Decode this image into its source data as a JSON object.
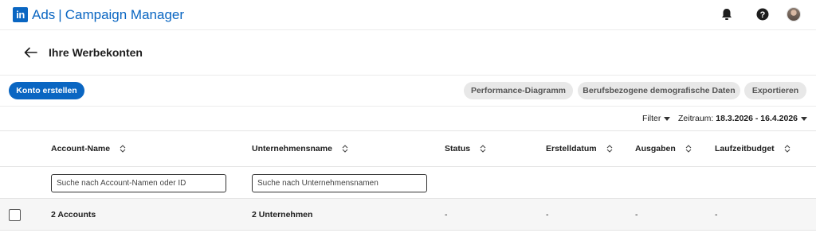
{
  "header": {
    "logo_text": "in",
    "product": "Ads",
    "app_name": "Campaign Manager",
    "brand_color": "#0a66c2",
    "icons": [
      "bell-icon",
      "help-icon",
      "avatar"
    ]
  },
  "page": {
    "title": "Ihre Werbekonten"
  },
  "actions": {
    "create_account": "Konto erstellen",
    "performance_chart": "Performance-Diagramm",
    "demographics": "Berufsbezogene demografische Daten",
    "export": "Exportieren"
  },
  "filter_bar": {
    "filter_label": "Filter",
    "date_range_label": "Zeitraum:",
    "date_range_value": "18.3.2026 - 16.4.2026"
  },
  "table": {
    "columns": [
      "Account-Name",
      "Unternehmensname",
      "Status",
      "Erstelldatum",
      "Ausgaben",
      "Laufzeitbudget"
    ],
    "search_account_placeholder": "Suche nach Account-Namen oder ID",
    "search_company_placeholder": "Suche nach Unternehmensnamen",
    "total_row": {
      "accounts": "2 Accounts",
      "companies": "2 Unternehmen",
      "status": "-",
      "created": "-",
      "spend": "-",
      "budget": "-"
    }
  }
}
